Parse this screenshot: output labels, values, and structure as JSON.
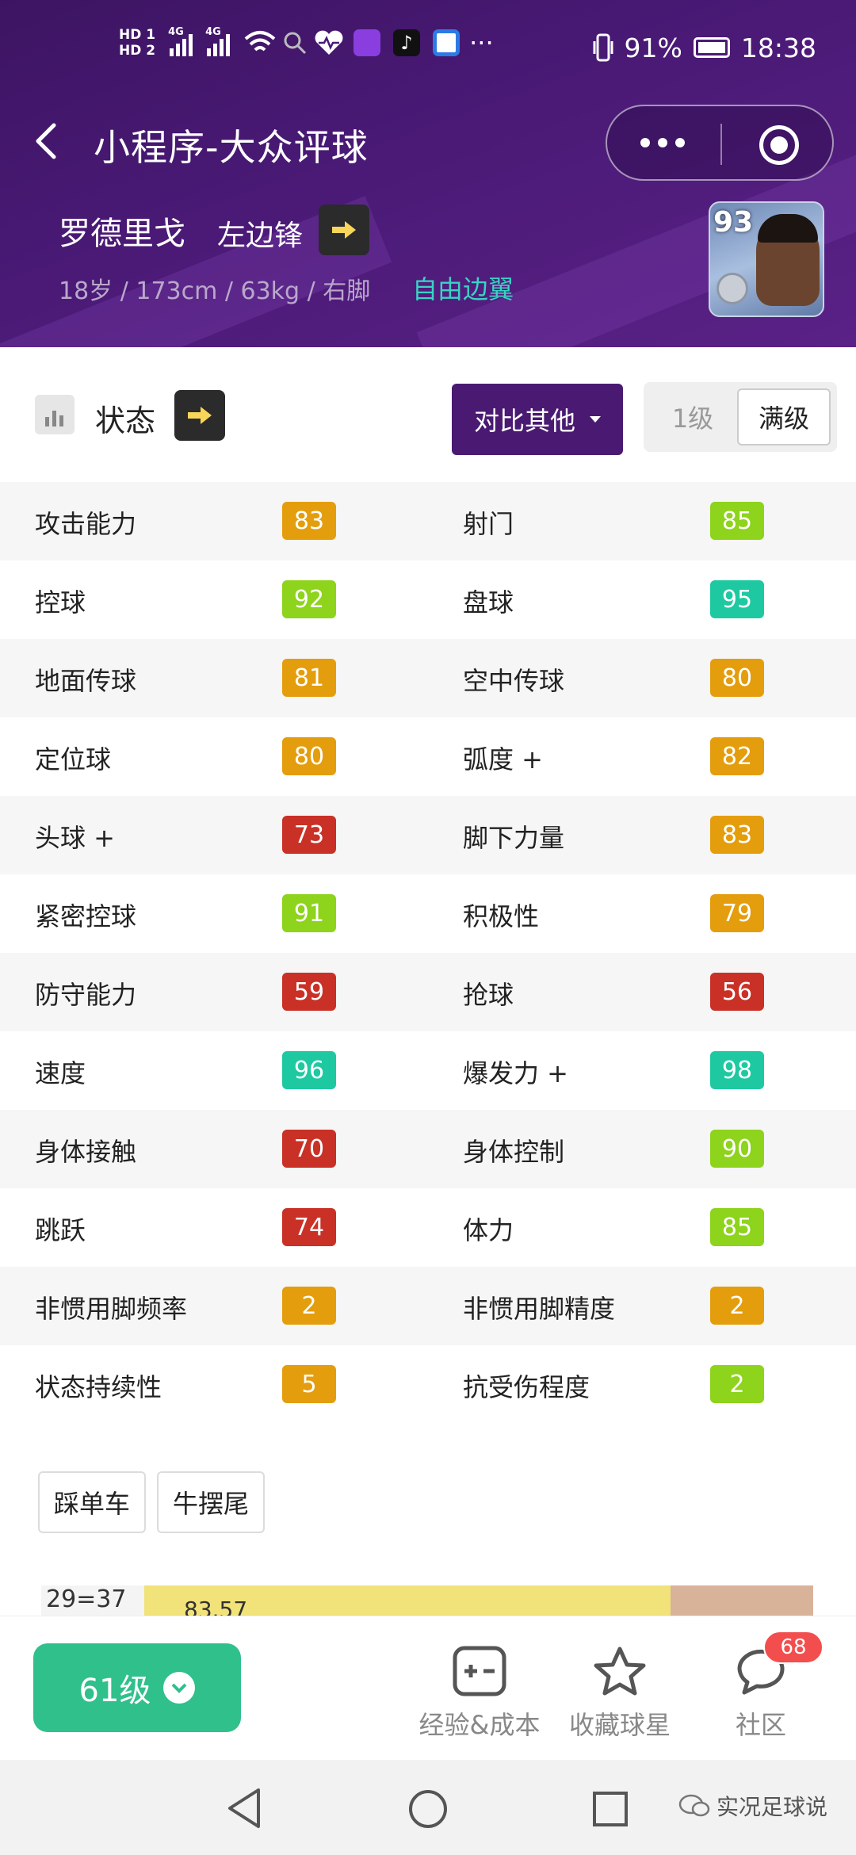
{
  "status_bar": {
    "hd1": "HD 1",
    "hd2": "HD 2",
    "net1": "4G",
    "net2": "4G",
    "more": "···",
    "battery": "91%",
    "time": "18:38"
  },
  "nav": {
    "title": "小程序-大众评球"
  },
  "player": {
    "name": "罗德里戈",
    "position": "左边锋",
    "meta": "18岁 / 173cm / 63kg / 右脚",
    "play_style": "自由边翼",
    "card_rating": "93"
  },
  "section": {
    "title": "状态",
    "compare_label": "对比其他",
    "level_options": [
      "1级",
      "满级"
    ],
    "selected_level": "满级"
  },
  "colors": {
    "orange": "#e49d0c",
    "lime": "#8ed31c",
    "teal": "#1ec9a2",
    "red": "#c93127",
    "header_purple": "#4a1a76",
    "green_button": "#30c08c"
  },
  "stats": [
    {
      "left": {
        "label": "攻击能力",
        "value": "83",
        "color": "orange"
      },
      "right": {
        "label": "射门",
        "value": "85",
        "color": "lime"
      }
    },
    {
      "left": {
        "label": "控球",
        "value": "92",
        "color": "lime"
      },
      "right": {
        "label": "盘球",
        "value": "95",
        "color": "teal"
      }
    },
    {
      "left": {
        "label": "地面传球",
        "value": "81",
        "color": "orange"
      },
      "right": {
        "label": "空中传球",
        "value": "80",
        "color": "orange"
      }
    },
    {
      "left": {
        "label": "定位球",
        "value": "80",
        "color": "orange"
      },
      "right": {
        "label": "弧度 +",
        "value": "82",
        "color": "orange"
      }
    },
    {
      "left": {
        "label": "头球 +",
        "value": "73",
        "color": "red"
      },
      "right": {
        "label": "脚下力量",
        "value": "83",
        "color": "orange"
      }
    },
    {
      "left": {
        "label": "紧密控球",
        "value": "91",
        "color": "lime"
      },
      "right": {
        "label": "积极性",
        "value": "79",
        "color": "orange"
      }
    },
    {
      "left": {
        "label": "防守能力",
        "value": "59",
        "color": "red"
      },
      "right": {
        "label": "抢球",
        "value": "56",
        "color": "red"
      }
    },
    {
      "left": {
        "label": "速度",
        "value": "96",
        "color": "teal"
      },
      "right": {
        "label": "爆发力 +",
        "value": "98",
        "color": "teal"
      }
    },
    {
      "left": {
        "label": "身体接触",
        "value": "70",
        "color": "red"
      },
      "right": {
        "label": "身体控制",
        "value": "90",
        "color": "lime"
      }
    },
    {
      "left": {
        "label": "跳跃",
        "value": "74",
        "color": "red"
      },
      "right": {
        "label": "体力",
        "value": "85",
        "color": "lime"
      }
    },
    {
      "left": {
        "label": "非惯用脚频率",
        "value": "2",
        "color": "orange"
      },
      "right": {
        "label": "非惯用脚精度",
        "value": "2",
        "color": "orange"
      }
    },
    {
      "left": {
        "label": "状态持续性",
        "value": "5",
        "color": "orange"
      },
      "right": {
        "label": "抗受伤程度",
        "value": "2",
        "color": "lime"
      }
    }
  ],
  "skills": [
    "踩单车",
    "牛摆尾"
  ],
  "preview": {
    "text1": "29=37",
    "text2": "83.57"
  },
  "bottom_bar": {
    "level_label": "61级",
    "items": [
      {
        "label": "经验&成本",
        "icon": "plus-minus-icon"
      },
      {
        "label": "收藏球星",
        "icon": "star-icon"
      },
      {
        "label": "社区",
        "icon": "chat-bubble-icon",
        "badge": "68"
      }
    ]
  },
  "watermark": "实况足球说"
}
